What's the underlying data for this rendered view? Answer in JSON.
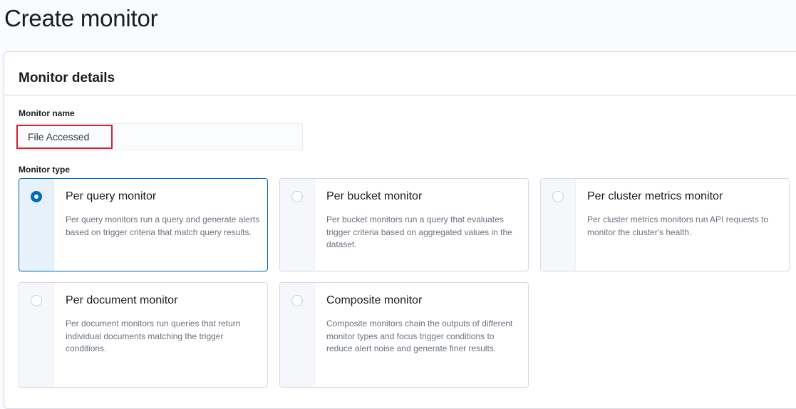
{
  "page": {
    "title": "Create monitor"
  },
  "monitor_details": {
    "title": "Monitor details",
    "name_label": "Monitor name",
    "name_value": "File Accessed",
    "type_label": "Monitor type"
  },
  "monitor_types": [
    {
      "title": "Per query monitor",
      "description": "Per query monitors run a query and generate alerts based on trigger criteria that match query results.",
      "selected": true
    },
    {
      "title": "Per bucket monitor",
      "description": "Per bucket monitors run a query that evaluates trigger criteria based on aggregated values in the dataset.",
      "selected": false
    },
    {
      "title": "Per cluster metrics monitor",
      "description": "Per cluster metrics monitors run API requests to monitor the cluster's health.",
      "selected": false
    },
    {
      "title": "Per document monitor",
      "description": "Per document monitors run queries that return individual documents matching the trigger conditions.",
      "selected": false
    },
    {
      "title": "Composite monitor",
      "description": "Composite monitors chain the outputs of different monitor types and focus trigger conditions to reduce alert noise and generate finer results.",
      "selected": false
    }
  ],
  "colors": {
    "accent": "#006bb8",
    "highlight": "#d1222b",
    "border": "#d3dae6",
    "text": "#1a1c21",
    "subdued_text": "#69707d"
  }
}
